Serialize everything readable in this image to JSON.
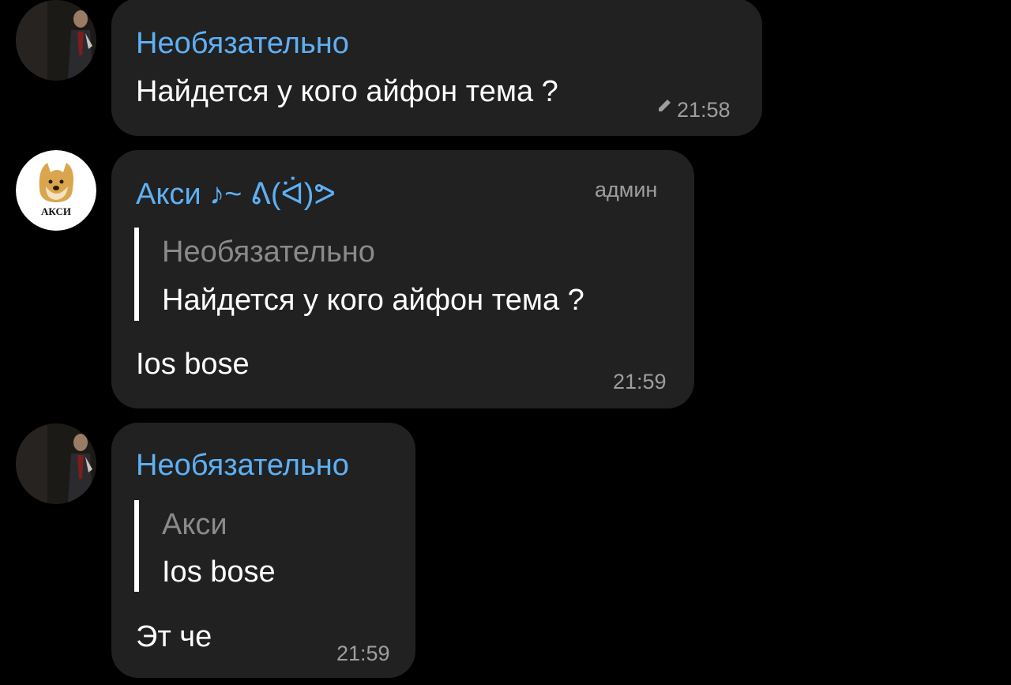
{
  "messages": [
    {
      "sender": "Необязательно",
      "text": "Найдется  у кого айфон тема ?",
      "time": "21:58",
      "edited": true
    },
    {
      "sender": "Акси ♪~ ᕕ(ᐛ)ᕗ",
      "role": "админ",
      "avatar_text": "АКСИ",
      "reply": {
        "sender": "Необязательно",
        "text": "Найдется  у кого айфон тема ?"
      },
      "text": "Ios bose",
      "time": "21:59"
    },
    {
      "sender": "Необязательно",
      "reply": {
        "sender": "Акси",
        "text": "Ios bose"
      },
      "text": "Эт че",
      "time": "21:59"
    }
  ],
  "colors": {
    "background": "#000000",
    "bubble": "#212121",
    "sender_name": "#5fb0f4",
    "timestamp": "#9e9e9e",
    "reply_name": "#8a8a8a"
  }
}
